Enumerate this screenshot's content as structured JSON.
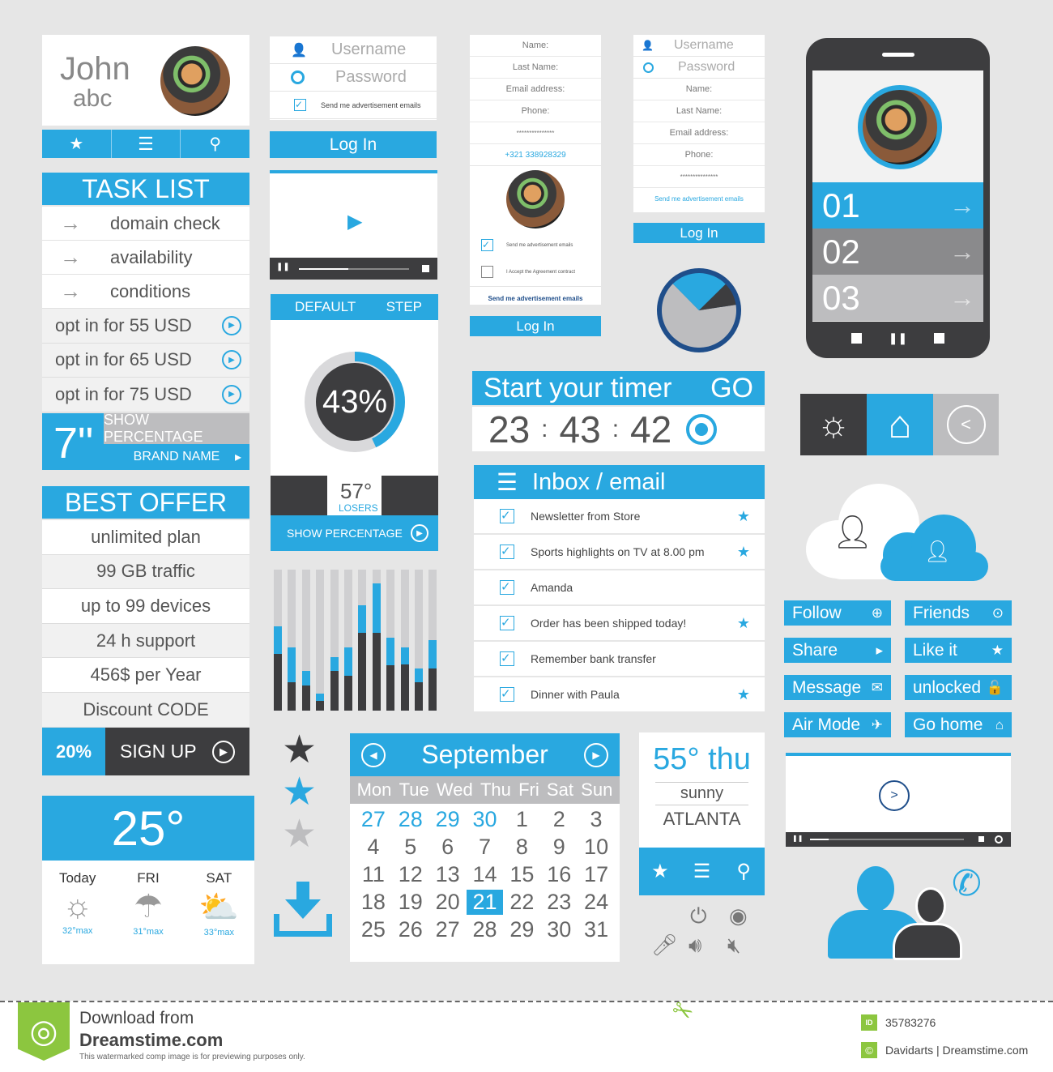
{
  "colors": {
    "accent": "#29a8e0",
    "dark": "#3d3d3f",
    "gray": "#bdbdbf",
    "background": "#e6e6e6"
  },
  "profile": {
    "first_name": "John",
    "last_name": "abc",
    "nav_icons": [
      "star-icon",
      "menu-icon",
      "pin-icon"
    ]
  },
  "task_list": {
    "title": "TASK LIST",
    "items": [
      "domain check",
      "availability",
      "conditions"
    ],
    "options": [
      "opt in for 55 USD",
      "opt in for 65 USD",
      "opt in for 75 USD"
    ]
  },
  "brand_block": {
    "size": "7\"",
    "show_percentage": "SHOW PERCENTAGE",
    "brand_name": "BRAND NAME"
  },
  "best_offer": {
    "title": "BEST OFFER",
    "items": [
      "unlimited plan",
      "99 GB traffic",
      "up to 99 devices",
      "24 h support",
      "456$ per Year",
      "Discount CODE"
    ],
    "discount": "20%",
    "signup": "SIGN UP"
  },
  "weather_big": {
    "temp": "25°",
    "days": [
      {
        "label": "Today",
        "max": "32°max",
        "icon": "sun-icon"
      },
      {
        "label": "FRI",
        "max": "31°max",
        "icon": "rain-cloud-icon"
      },
      {
        "label": "SAT",
        "max": "33°max",
        "icon": "sun-cloud-icon"
      }
    ]
  },
  "login1": {
    "username": "Username",
    "password": "Password",
    "checkbox": "Send me advertisement emails",
    "login": "Log In"
  },
  "percent_panel": {
    "tab_default": "DEFAULT",
    "tab_step": "STEP",
    "percent": "43%",
    "percent_value": 43,
    "temp": "57°",
    "temp_label": "LOSERS",
    "show_percentage": "SHOW PERCENTAGE"
  },
  "video1": {
    "progress": 0.45
  },
  "bar_widget": {
    "bars": [
      {
        "total": 0.6,
        "blue": 0.2
      },
      {
        "total": 0.45,
        "blue": 0.25
      },
      {
        "total": 0.28,
        "blue": 0.1
      },
      {
        "total": 0.12,
        "blue": 0.05
      },
      {
        "total": 0.38,
        "blue": 0.1
      },
      {
        "total": 0.45,
        "blue": 0.2
      },
      {
        "total": 0.75,
        "blue": 0.2
      },
      {
        "total": 0.9,
        "blue": 0.35
      },
      {
        "total": 0.52,
        "blue": 0.2
      },
      {
        "total": 0.45,
        "blue": 0.12
      },
      {
        "total": 0.3,
        "blue": 0.1
      },
      {
        "total": 0.5,
        "blue": 0.2
      }
    ]
  },
  "ratings": {
    "stars": [
      "dark",
      "blue",
      "gray"
    ]
  },
  "calendar": {
    "month": "September",
    "weekdays": [
      "Mon",
      "Tue",
      "Wed",
      "Thu",
      "Fri",
      "Sat",
      "Sun"
    ],
    "days": [
      "27",
      "28",
      "29",
      "30",
      "1",
      "2",
      "3",
      "4",
      "5",
      "6",
      "7",
      "8",
      "9",
      "10",
      "11",
      "12",
      "13",
      "14",
      "15",
      "16",
      "17",
      "18",
      "19",
      "20",
      "21",
      "22",
      "23",
      "24",
      "25",
      "26",
      "27",
      "28",
      "29",
      "30",
      "31"
    ],
    "prev_month_count": 4,
    "selected": "21"
  },
  "register": {
    "fields": [
      "Name:",
      "Last Name:",
      "Email address:",
      "Phone:",
      "***************"
    ],
    "phone_value": "+321 338928329",
    "check1": "Send me advertisement emails",
    "check2": "I Accept the Agreement contract",
    "link": "Send me advertisement emails",
    "login": "Log In"
  },
  "register2": {
    "username": "Username",
    "password": "Password",
    "fields": [
      "Name:",
      "Last Name:",
      "Email address:",
      "Phone:",
      "***************"
    ],
    "link": "Send me advertisement emails",
    "login": "Log In"
  },
  "pie": {
    "slices": [
      {
        "value": 65,
        "color": "#bdbdbf"
      },
      {
        "value": 25,
        "color": "#29a8e0"
      },
      {
        "value": 10,
        "color": "#3d3d3f"
      }
    ]
  },
  "timer": {
    "title": "Start your timer",
    "go": "GO",
    "hours": "23",
    "minutes": "43",
    "seconds": "42"
  },
  "inbox": {
    "title": "Inbox / email",
    "items": [
      {
        "text": "Newsletter from Store",
        "starred": true
      },
      {
        "text": "Sports highlights on TV at 8.00 pm",
        "starred": true
      },
      {
        "text": "Amanda",
        "starred": false
      },
      {
        "text": "Order has been shipped today!",
        "starred": true
      },
      {
        "text": "Remember bank transfer",
        "starred": false
      },
      {
        "text": "Dinner with Paula",
        "starred": true
      }
    ]
  },
  "weather_small": {
    "temp": "55°",
    "day": "thu",
    "condition": "sunny",
    "city": "ATLANTA"
  },
  "phone": {
    "items": [
      "01",
      "02",
      "03"
    ]
  },
  "buttons": [
    {
      "label": "Follow",
      "icon": "plus-circle-icon",
      "glyph": "⊕"
    },
    {
      "label": "Friends",
      "icon": "dot-circle-icon",
      "glyph": "⊙"
    },
    {
      "label": "Share",
      "icon": "arrow-circle-icon",
      "glyph": "▸"
    },
    {
      "label": "Like it",
      "icon": "star-icon",
      "glyph": "★"
    },
    {
      "label": "Message",
      "icon": "envelope-icon",
      "glyph": "✉"
    },
    {
      "label": "unlocked",
      "icon": "unlock-icon",
      "glyph": "🔓"
    },
    {
      "label": "Air Mode",
      "icon": "airplane-icon",
      "glyph": "✈"
    },
    {
      "label": "Go home",
      "icon": "home-icon",
      "glyph": "⌂"
    }
  ],
  "video2": {
    "progress": 0.12
  },
  "footer": {
    "download": "Download from",
    "brand": "Dreamstime.com",
    "disclaimer": "This watermarked comp image is for previewing purposes only.",
    "id": "35783276",
    "credit": "Davidarts | Dreamstime.com"
  }
}
